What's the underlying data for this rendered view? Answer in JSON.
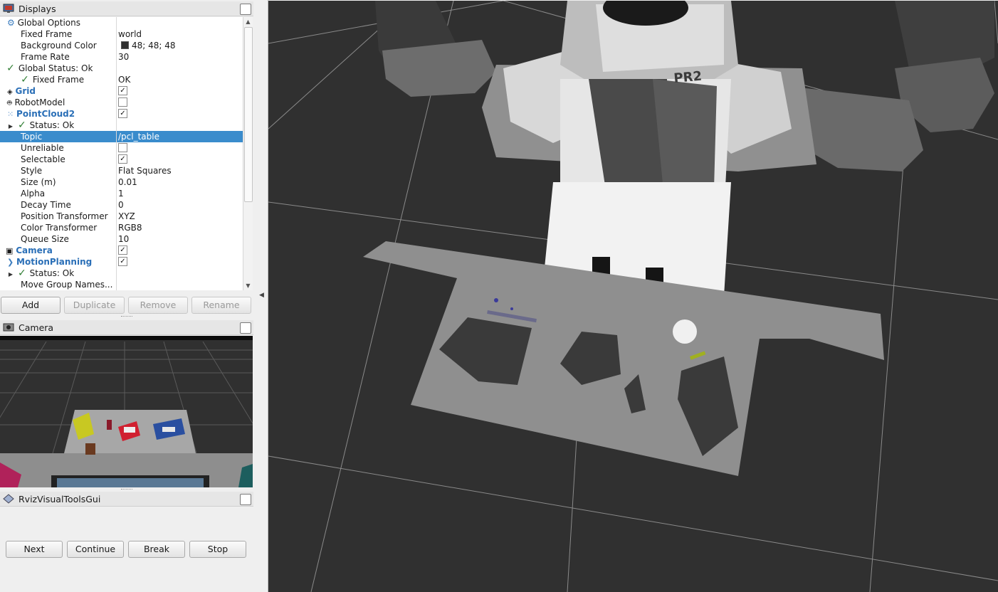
{
  "displays": {
    "title": "Displays",
    "rows": [
      {
        "name": "Global Options",
        "value": ""
      },
      {
        "name": "Fixed Frame",
        "value": "world"
      },
      {
        "name": "Background Color",
        "value": "48; 48; 48"
      },
      {
        "name": "Frame Rate",
        "value": "30"
      },
      {
        "name": "Global Status: Ok",
        "value": ""
      },
      {
        "name": "Fixed Frame",
        "value": "OK"
      },
      {
        "name": "Grid",
        "value": ""
      },
      {
        "name": "RobotModel",
        "value": ""
      },
      {
        "name": "PointCloud2",
        "value": ""
      },
      {
        "name": "Status: Ok",
        "value": ""
      },
      {
        "name": "Topic",
        "value": "/pcl_table"
      },
      {
        "name": "Unreliable",
        "value": ""
      },
      {
        "name": "Selectable",
        "value": ""
      },
      {
        "name": "Style",
        "value": "Flat Squares"
      },
      {
        "name": "Size (m)",
        "value": "0.01"
      },
      {
        "name": "Alpha",
        "value": "1"
      },
      {
        "name": "Decay Time",
        "value": "0"
      },
      {
        "name": "Position Transformer",
        "value": "XYZ"
      },
      {
        "name": "Color Transformer",
        "value": "RGB8"
      },
      {
        "name": "Queue Size",
        "value": "10"
      },
      {
        "name": "Camera",
        "value": ""
      },
      {
        "name": "MotionPlanning",
        "value": ""
      },
      {
        "name": "Status: Ok",
        "value": ""
      },
      {
        "name": "Move Group Names...",
        "value": ""
      }
    ],
    "checks": {
      "grid": true,
      "robot_model": false,
      "pointcloud2": true,
      "unreliable": false,
      "selectable": true,
      "camera": true,
      "motion_planning": true
    },
    "buttons": {
      "add": "Add",
      "duplicate": "Duplicate",
      "remove": "Remove",
      "rename": "Rename"
    }
  },
  "camera_panel": {
    "title": "Camera"
  },
  "rviz_tools": {
    "title": "RvizVisualToolsGui",
    "buttons": {
      "next": "Next",
      "continue": "Continue",
      "break": "Break",
      "stop": "Stop"
    }
  },
  "viewport": {
    "robot_label": "PR2",
    "background_color": "#303030",
    "grid_color": "#8a8a8a",
    "cloud_color": "#8f8f8f"
  },
  "icons": [
    "monitor-icon",
    "gear-icon",
    "checkmark-icon",
    "grid-icon",
    "robot-icon",
    "pointcloud-icon",
    "camera-icon",
    "motion-planning-icon",
    "expand-arrow-icon"
  ]
}
